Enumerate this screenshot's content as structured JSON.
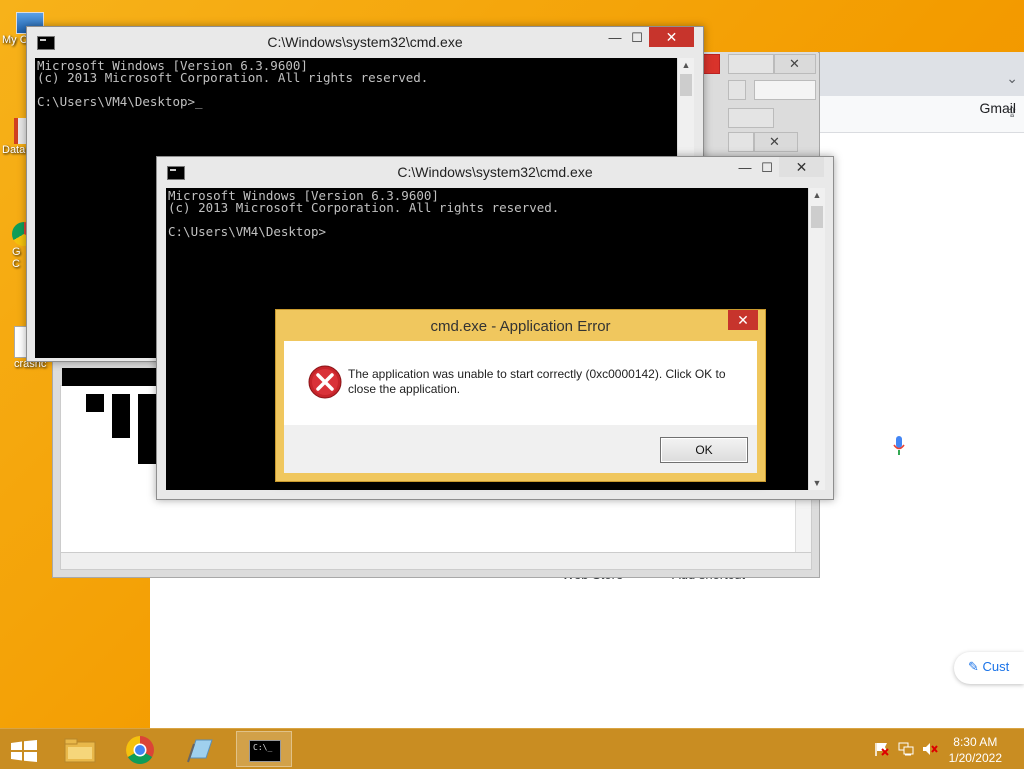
{
  "desktop": {
    "icons": [
      {
        "label": "My C"
      },
      {
        "label": "Data"
      },
      {
        "label": "G"
      },
      {
        "label": "C"
      },
      {
        "label": "crashc"
      }
    ]
  },
  "browser": {
    "gmail_link": "Gmail",
    "shortcuts": [
      "Web Store",
      "Add shortcut"
    ],
    "customize_label": "Cust"
  },
  "cmd_back": {
    "title": "C:\\Windows\\system32\\cmd.exe",
    "lines": "Microsoft Windows [Version 6.3.9600]\n(c) 2013 Microsoft Corporation. All rights reserved.\n\nC:\\Users\\VM4\\Desktop>_"
  },
  "cmd_front": {
    "title": "C:\\Windows\\system32\\cmd.exe",
    "lines": "Microsoft Windows [Version 6.3.9600]\n(c) 2013 Microsoft Corporation. All rights reserved.\n\nC:\\Users\\VM4\\Desktop>"
  },
  "window_controls": {
    "minimize": "—",
    "maximize": "☐",
    "close": "✕"
  },
  "error_dialog": {
    "title": "cmd.exe - Application Error",
    "message": "The application was unable to start correctly (0xc0000142). Click OK to close the application.",
    "ok_label": "OK",
    "close": "✕"
  },
  "taskbar": {
    "time": "8:30 AM",
    "date": "1/20/2022"
  },
  "colors": {
    "desktop": "#f39c00",
    "taskbar": "#c98d22",
    "close_red": "#c7342c",
    "dialog_frame": "#f0c75e"
  }
}
